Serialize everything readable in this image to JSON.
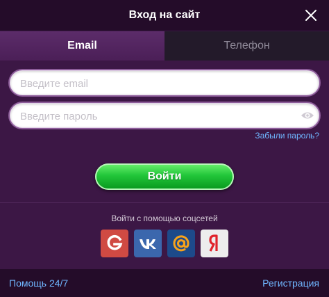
{
  "title": "Вход на сайт",
  "tabs": [
    {
      "label": "Email",
      "active": true
    },
    {
      "label": "Телефон",
      "active": false
    }
  ],
  "form": {
    "email_placeholder": "Введите email",
    "password_placeholder": "Введите пароль",
    "forgot_label": "Забыли пароль?",
    "submit_label": "Войти"
  },
  "social": {
    "label": "Войти с помощью соцсетей",
    "icons": [
      "google-icon",
      "vk-icon",
      "mail-ru-icon",
      "yandex-icon"
    ]
  },
  "footer": {
    "help_label": "Помощь 24/7",
    "register_label": "Регистрация"
  },
  "colors": {
    "accent_link": "#6fb6ff",
    "login_button": "#22c63a",
    "background": "#3c1745"
  }
}
